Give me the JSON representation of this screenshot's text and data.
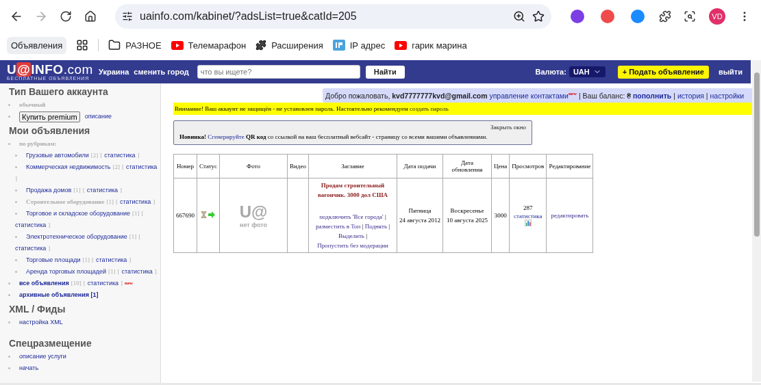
{
  "browser": {
    "url": "uainfo.com/kabinet/?adsList=true&catId=205",
    "avatar": "VD",
    "bookmarks": [
      {
        "label": "Объявления",
        "kind": "chip"
      },
      {
        "kind": "apps"
      },
      {
        "label": "РАЗНОЕ",
        "kind": "folder"
      },
      {
        "label": "Телемарафон",
        "kind": "video"
      },
      {
        "label": "Расширения",
        "kind": "puzzle"
      },
      {
        "label": "IP адрес",
        "kind": "ip"
      },
      {
        "label": "гарик марина",
        "kind": "video"
      }
    ]
  },
  "header": {
    "logo": {
      "left": "U",
      "mark": "@",
      "right": "INFO",
      "suffix": ".com",
      "tagline": "БЕСПЛАТНЫЕ ОБЪЯВЛЕНИЯ"
    },
    "region": "Украина",
    "change_city": "сменить город",
    "search": {
      "placeholder": "что вы ищете?"
    },
    "search_button": "Найти",
    "currency_label": "Валюта:",
    "currency": "UAH",
    "add_button": "+ Подать объявление",
    "logout": "выйти"
  },
  "sidebar": {
    "brackets": [
      "[",
      "]"
    ],
    "account": {
      "title": "Тип Вашего аккаунта",
      "type": "обычный",
      "premium_button": "Купить premium",
      "description": "описание"
    },
    "ads": {
      "title": "Мои объявления",
      "group": "по рубрикам:",
      "categories": [
        {
          "name": "Грузовые автомобили",
          "count": "[2]",
          "stats": "статистика",
          "disabled": false
        },
        {
          "name": "Коммерческая недвижимость",
          "count": "[2]",
          "stats": "статистика",
          "disabled": false
        },
        {
          "name": "Продажа домов",
          "count": "[1]",
          "stats": "статистика",
          "disabled": false
        },
        {
          "name": "Строительное оборудование",
          "count": "[1]",
          "stats": "статистика",
          "disabled": true
        },
        {
          "name": "Торговое и складское оборудование",
          "count": "[1]",
          "stats": "статистика",
          "disabled": false
        },
        {
          "name": "Электротехническое оборудование",
          "count": "[1]",
          "stats": "статистика",
          "disabled": false
        },
        {
          "name": "Торговые площади",
          "count": "[1]",
          "stats": "статистика",
          "disabled": false
        },
        {
          "name": "Аренда торговых площадей",
          "count": "[1]",
          "stats": "статистика",
          "disabled": false
        }
      ],
      "all": {
        "label": "все объявления",
        "count": "[10]",
        "stats": "статистика",
        "badge": "new"
      },
      "archive": "архивные объявления [1]"
    },
    "xml": {
      "title": "XML / Фиды",
      "links": [
        "настройка XML"
      ]
    },
    "special": {
      "title": "Спецразмещение",
      "links": [
        "описание услуги",
        "начать"
      ]
    }
  },
  "welcome": {
    "greeting": "Добро пожаловать,",
    "email": "kvd7777777kvd@gmail.com",
    "contacts": "управление контактами",
    "badge": "new",
    "balance": "| Ваш баланс: ₴",
    "topup": "пополнить",
    "history": "история",
    "settings": "настройки",
    "separator": "|"
  },
  "warning": {
    "text": "Внимание! Ваш аккаунт не защищён - не установлен пароль. Настоятельно рекомендуем",
    "link": "создать пароль"
  },
  "notice": {
    "close": "Закрыть окно",
    "before": "**Новинка!**",
    "link": "Сгенерируйте",
    "after": "**QR код** со ссылкой на ваш бесплатный вебсайт - страницу со всеми вашими объявлениями."
  },
  "table": {
    "columns": [
      "Номер",
      "Статус",
      "Фото",
      "Видео",
      "Заглавие",
      "Дата подачи",
      "Дата обновления",
      "Цена",
      "Просмотров",
      "Редактирование"
    ],
    "rows": [
      {
        "number": "667690",
        "photo": {
          "mark": "U@",
          "caption": "нет фото"
        },
        "title": "Продам строительный вагончик. 3000 дол США",
        "actions": [
          "подключить 'Все города'",
          "разместить в Топ",
          "Поднять",
          "Выделить",
          "Пропустить без модерации"
        ],
        "separator": "|",
        "submitted": [
          "Пятница",
          "24 августа 2012"
        ],
        "updated": [
          "Воскресенье",
          "10 августа 2025"
        ],
        "price": "3000",
        "views": "287",
        "stats": "статистика",
        "edit": "редактировать"
      }
    ]
  }
}
